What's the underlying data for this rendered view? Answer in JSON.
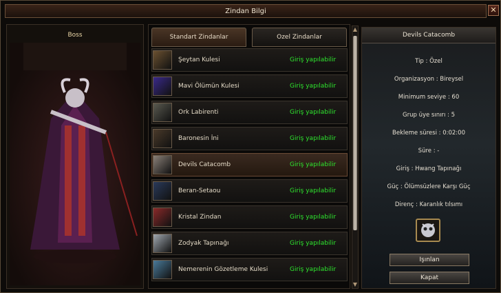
{
  "window": {
    "title": "Zindan Bilgi",
    "close_symbol": "✕"
  },
  "boss": {
    "label": "Boss"
  },
  "tabs": [
    {
      "label": "Standart Zindanlar"
    },
    {
      "label": "Ozel Zindanlar"
    }
  ],
  "dungeons": [
    {
      "name": "Şeytan Kulesi",
      "status": "Giriş yapılabilir",
      "thumb_color": "#6a5030"
    },
    {
      "name": "Mavi Ölümün Kulesi",
      "status": "Giriş yapılabilir",
      "thumb_color": "#3a2a8a"
    },
    {
      "name": "Ork Labirenti",
      "status": "Giriş yapılabilir",
      "thumb_color": "#5a5a50"
    },
    {
      "name": "Baronesin İni",
      "status": "Giriş yapılabilir",
      "thumb_color": "#4a3a2a"
    },
    {
      "name": "Devils Catacomb",
      "status": "Giriş yapılabilir",
      "thumb_color": "#8a8078"
    },
    {
      "name": "Beran-Setaou",
      "status": "Giriş yapılabilir",
      "thumb_color": "#2a3a5a"
    },
    {
      "name": "Kristal Zindan",
      "status": "Giriş yapılabilir",
      "thumb_color": "#8a2a2a"
    },
    {
      "name": "Zodyak Tapınağı",
      "status": "Giriş yapılabilir",
      "thumb_color": "#a0a8b0"
    },
    {
      "name": "Nemerenin Gözetleme Kulesi",
      "status": "Giriş yapılabilir",
      "thumb_color": "#4a7a9a"
    }
  ],
  "selected_index": 4,
  "info": {
    "title": "Devils Catacomb",
    "lines": [
      "Tip : Özel",
      "Organizasyon : Bireysel",
      "Minimum seviye : 60",
      "Grup üye sınırı : 5",
      "Bekleme süresi : 0:02:00",
      "Süre :  -",
      "Giriş : Hwang Tapınağı",
      "Güç : Ölümsüzlere Karşı Güç",
      "Direnç : Karanlık tılsımı"
    ],
    "enter_button": "Işınlan",
    "close_button": "Kapat"
  },
  "colors": {
    "status_green": "#2ee62e",
    "accent": "#8a7050"
  }
}
